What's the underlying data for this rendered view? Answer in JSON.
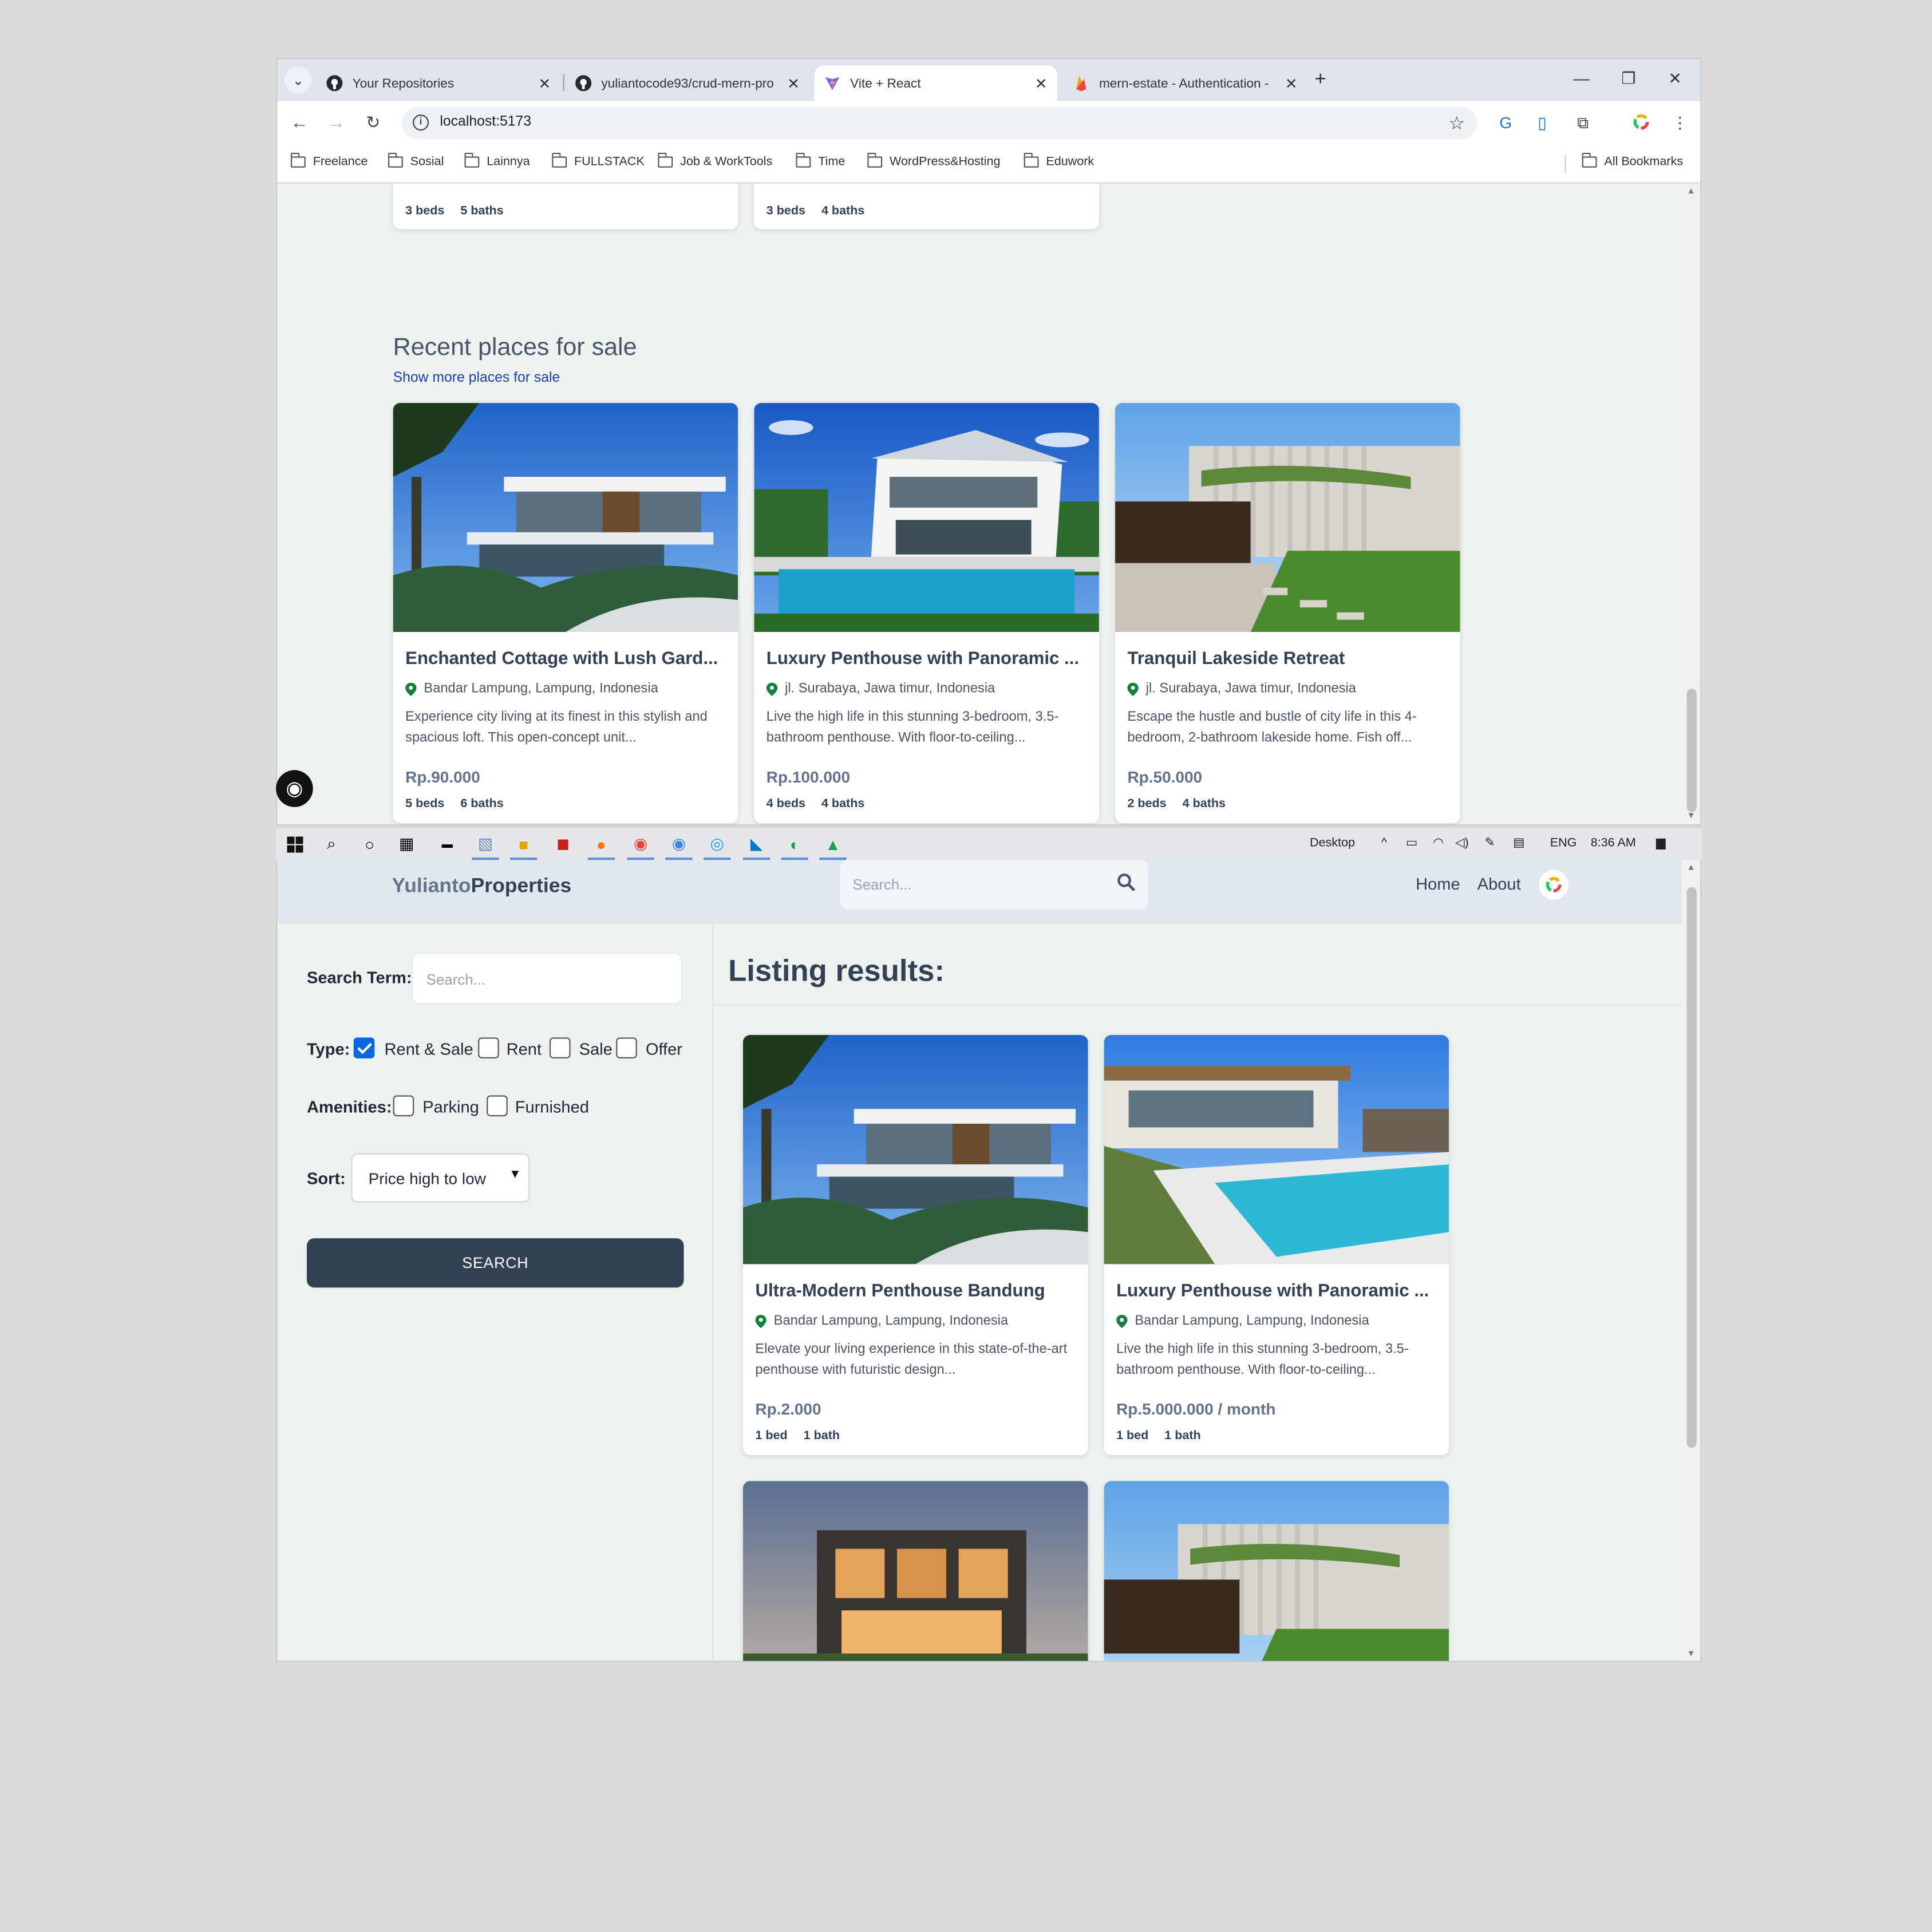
{
  "browser": {
    "tabs": [
      {
        "title": "Your Repositories",
        "icon": "github-icon",
        "active": false
      },
      {
        "title": "yuliantocode93/crud-mern-pro",
        "icon": "github-icon",
        "active": false
      },
      {
        "title": "Vite + React",
        "icon": "vite-icon",
        "active": true
      },
      {
        "title": "mern-estate - Authentication -",
        "icon": "firebase-icon",
        "active": false
      }
    ],
    "url": "localhost:5173",
    "bookmarks": [
      "Freelance",
      "Sosial",
      "Lainnya",
      "FULLSTACK",
      "Job & WorkTools",
      "Time",
      "WordPress&Hosting",
      "Eduwork"
    ],
    "all_bookmarks": "All Bookmarks"
  },
  "upper_page": {
    "prev_cards": [
      {
        "beds": "3 beds",
        "baths": "5 baths"
      },
      {
        "beds": "3 beds",
        "baths": "4 baths"
      }
    ],
    "section_title": "Recent places for sale",
    "section_link": "Show more places for sale",
    "cards": [
      {
        "title": "Enchanted Cottage with Lush Gard...",
        "location": "Bandar Lampung, Lampung, Indonesia",
        "description": "Experience city living at its finest in this stylish and spacious loft. This open-concept unit...",
        "price": "Rp.90.000",
        "beds": "5 beds",
        "baths": "6 baths"
      },
      {
        "title": "Luxury Penthouse with Panoramic ...",
        "location": "jl. Surabaya, Jawa timur, Indonesia",
        "description": "Live the high life in this stunning 3-bedroom, 3.5-bathroom penthouse. With floor-to-ceiling...",
        "price": "Rp.100.000",
        "beds": "4 beds",
        "baths": "4 baths"
      },
      {
        "title": "Tranquil Lakeside Retreat",
        "location": "jl. Surabaya, Jawa timur, Indonesia",
        "description": "Escape the hustle and bustle of city life in this 4-bedroom, 2-bathroom lakeside home. Fish off...",
        "price": "Rp.50.000",
        "beds": "2 beds",
        "baths": "4 baths"
      }
    ]
  },
  "taskbar": {
    "desktop_label": "Desktop",
    "lang": "ENG",
    "time": "8:36 AM"
  },
  "app": {
    "logo_part1": "Yulianto",
    "logo_part2": "Properties",
    "header_search_placeholder": "Search...",
    "nav": [
      "Home",
      "About"
    ],
    "sidebar": {
      "search_term_label": "Search Term:",
      "search_term_placeholder": "Search...",
      "type_label": "Type:",
      "type_options": [
        {
          "label": "Rent & Sale",
          "checked": true
        },
        {
          "label": "Rent",
          "checked": false
        },
        {
          "label": "Sale",
          "checked": false
        },
        {
          "label": "Offer",
          "checked": false
        }
      ],
      "amenities_label": "Amenities:",
      "amenities_options": [
        {
          "label": "Parking",
          "checked": false
        },
        {
          "label": "Furnished",
          "checked": false
        }
      ],
      "sort_label": "Sort:",
      "sort_value": "Price high to low",
      "search_button": "SEARCH"
    },
    "results_title": "Listing results:",
    "listings": [
      {
        "title": "Ultra-Modern Penthouse Bandung",
        "location": "Bandar Lampung, Lampung, Indonesia",
        "description": "Elevate your living experience in this state-of-the-art penthouse with futuristic design...",
        "price": "Rp.2.000",
        "beds": "1 bed",
        "baths": "1 bath"
      },
      {
        "title": "Luxury Penthouse with Panoramic ...",
        "location": "Bandar Lampung, Lampung, Indonesia",
        "description": "Live the high life in this stunning 3-bedroom, 3.5-bathroom penthouse. With floor-to-ceiling...",
        "price": "Rp.5.000.000 / month",
        "beds": "1 bed",
        "baths": "1 bath"
      }
    ]
  },
  "colors": {
    "accent": "#334155",
    "link": "#1e40af",
    "checkbox": "#0b66e4",
    "pin": "#15803d"
  }
}
